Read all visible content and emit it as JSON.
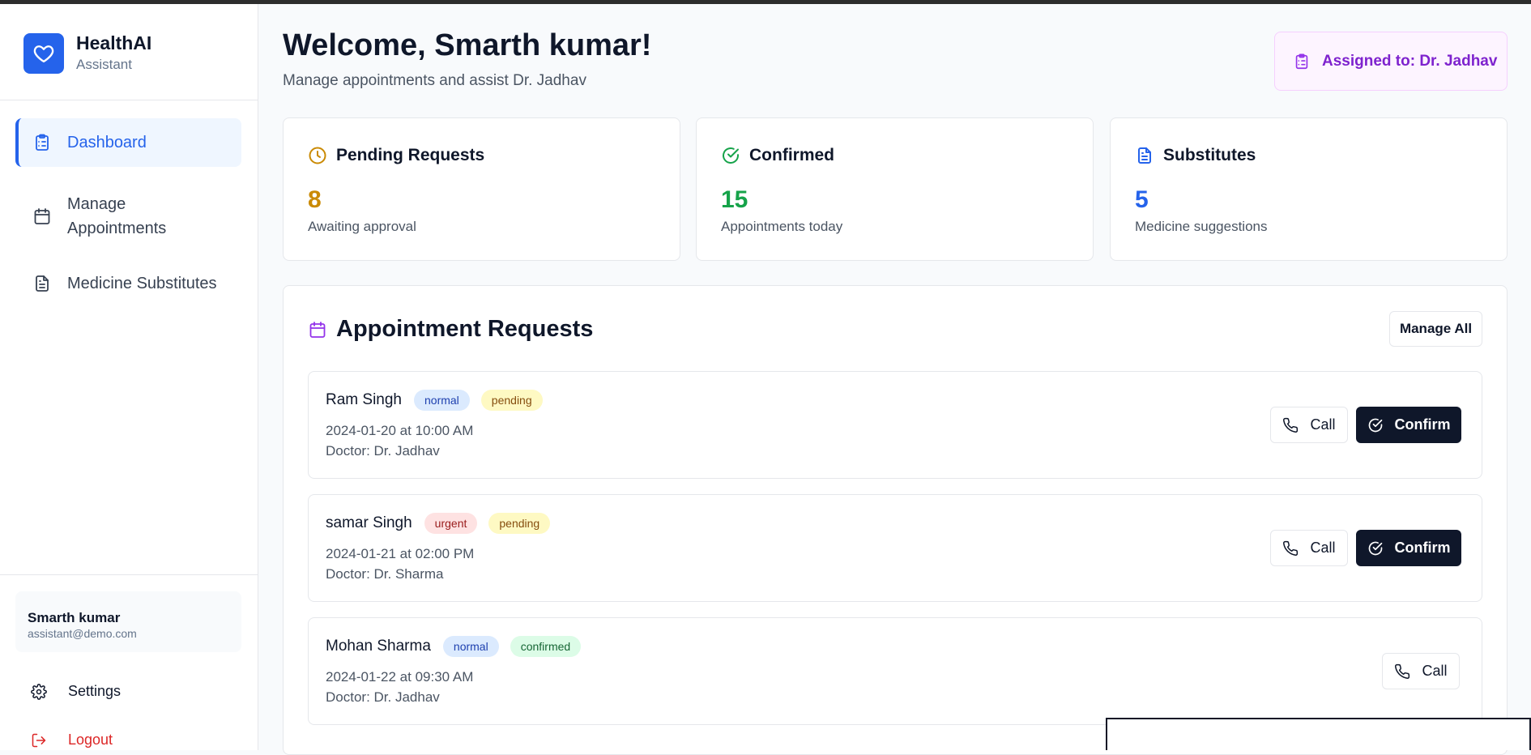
{
  "brand": {
    "name": "HealthAI",
    "role": "Assistant",
    "logo_icon": "heart-icon",
    "color": "#2563eb"
  },
  "sidebar": {
    "items": [
      {
        "label": "Dashboard",
        "icon": "clipboard-icon",
        "active": true
      },
      {
        "label": "Manage Appointments",
        "icon": "calendar-icon",
        "active": false
      },
      {
        "label": "Medicine Substitutes",
        "icon": "document-icon",
        "active": false
      }
    ],
    "user": {
      "name": "Smarth kumar",
      "email": "assistant@demo.com"
    },
    "settings_label": "Settings",
    "logout_label": "Logout"
  },
  "header": {
    "title": "Welcome, Smarth kumar!",
    "subtitle": "Manage appointments and assist Dr. Jadhav",
    "assigned_label": "Assigned to: Dr. Jadhav"
  },
  "stats": [
    {
      "title": "Pending Requests",
      "value": "8",
      "desc": "Awaiting approval",
      "icon": "clock-icon",
      "color": "#ca8a04"
    },
    {
      "title": "Confirmed",
      "value": "15",
      "desc": "Appointments today",
      "icon": "check-circle-icon",
      "color": "#16a34a"
    },
    {
      "title": "Substitutes",
      "value": "5",
      "desc": "Medicine suggestions",
      "icon": "document-icon",
      "color": "#2563eb"
    }
  ],
  "requests": {
    "title": "Appointment Requests",
    "manage_all_label": "Manage All",
    "call_label": "Call",
    "confirm_label": "Confirm",
    "items": [
      {
        "name": "Ram Singh",
        "priority": "normal",
        "status": "pending",
        "datetime": "2024-01-20 at 10:00 AM",
        "doctor": "Doctor: Dr. Jadhav"
      },
      {
        "name": "samar Singh",
        "priority": "urgent",
        "status": "pending",
        "datetime": "2024-01-21 at 02:00 PM",
        "doctor": "Doctor: Dr. Sharma"
      },
      {
        "name": "Mohan Sharma",
        "priority": "normal",
        "status": "confirmed",
        "datetime": "2024-01-22 at 09:30 AM",
        "doctor": "Doctor: Dr. Jadhav"
      }
    ]
  }
}
